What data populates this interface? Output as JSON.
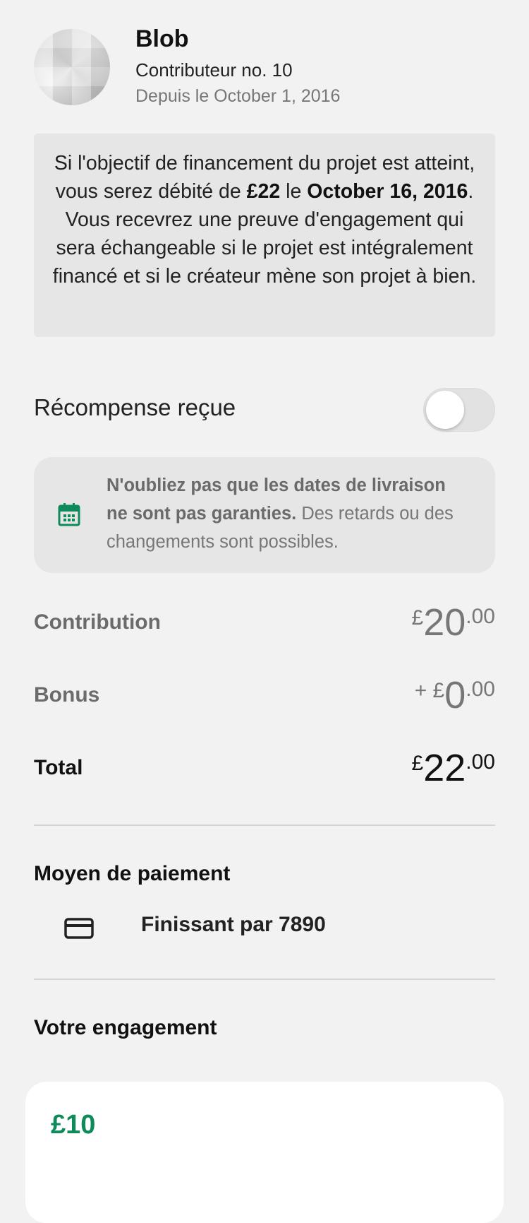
{
  "profile": {
    "name": "Blob",
    "contributor": "Contributeur no. 10",
    "since": "Depuis le October 1, 2016"
  },
  "notice": {
    "part1": "Si l'objectif de financement du projet est atteint, vous serez débité de ",
    "amount": "£22",
    "part2": " le ",
    "date": "October 16, 2016",
    "part3": ". Vous recevrez une preuve d'engagement qui sera échangeable si le projet est intégralement financé et si le créateur mène son projet à bien."
  },
  "reward_received": {
    "label": "Récompense reçue",
    "on": false
  },
  "delivery_notice": {
    "bold": "N'oubliez pas que les dates de livraison ne sont pas garanties.",
    "rest": " Des retards ou des changements sont possibles.",
    "icon": "calendar-icon",
    "icon_color": "#0f8a5a"
  },
  "summary": {
    "contribution": {
      "label": "Contribution",
      "currency": "£",
      "whole": "20",
      "cents": ".00"
    },
    "bonus": {
      "label": "Bonus",
      "prefix": "+ ",
      "currency": "£",
      "whole": "0",
      "cents": ".00"
    },
    "total": {
      "label": "Total",
      "currency": "£",
      "whole": "22",
      "cents": ".00"
    }
  },
  "payment": {
    "title": "Moyen de paiement",
    "icon": "credit-card-icon",
    "text": "Finissant par 7890"
  },
  "pledge": {
    "title": "Votre engagement",
    "amount": "£10",
    "accent": "#0f8a5a"
  }
}
